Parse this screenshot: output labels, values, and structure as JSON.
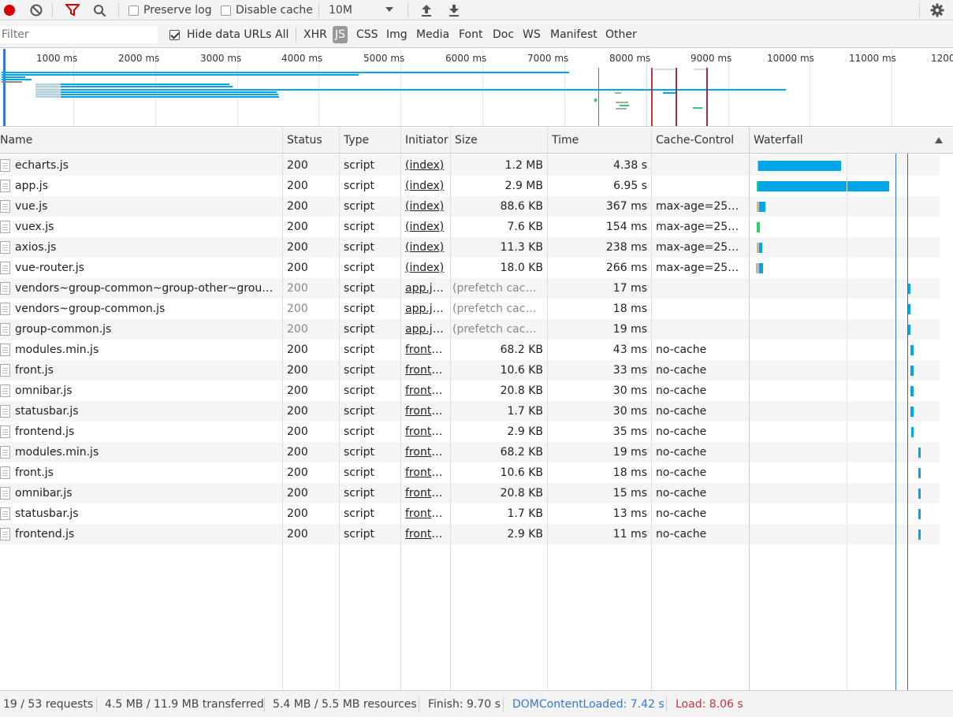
{
  "toolbar": {
    "preserve_log": "Preserve log",
    "disable_cache": "Disable cache",
    "throttle_value": "10M"
  },
  "filterbar": {
    "placeholder": "Filter",
    "hide_data_urls": "Hide data URLs",
    "types": [
      "All",
      "XHR",
      "JS",
      "CSS",
      "Img",
      "Media",
      "Font",
      "Doc",
      "WS",
      "Manifest",
      "Other"
    ],
    "active_type": "JS"
  },
  "overview": {
    "ticks": [
      "1000 ms",
      "2000 ms",
      "3000 ms",
      "4000 ms",
      "5000 ms",
      "6000 ms",
      "7000 ms",
      "8000 ms",
      "9000 ms",
      "10000 ms",
      "11000 ms",
      "1200"
    ]
  },
  "columns": {
    "name": "Name",
    "status": "Status",
    "type": "Type",
    "initiator": "Initiator",
    "size": "Size",
    "time": "Time",
    "cache_control": "Cache-Control",
    "waterfall": "Waterfall"
  },
  "rows": [
    {
      "name": "echarts.js",
      "status": "200",
      "type": "script",
      "initiator": "(index)",
      "size": "1.2 MB",
      "time": "4.38 s",
      "cache": ""
    },
    {
      "name": "app.js",
      "status": "200",
      "type": "script",
      "initiator": "(index)",
      "size": "2.9 MB",
      "time": "6.95 s",
      "cache": ""
    },
    {
      "name": "vue.js",
      "status": "200",
      "type": "script",
      "initiator": "(index)",
      "size": "88.6 KB",
      "time": "367 ms",
      "cache": "max-age=2592..."
    },
    {
      "name": "vuex.js",
      "status": "200",
      "type": "script",
      "initiator": "(index)",
      "size": "7.6 KB",
      "time": "154 ms",
      "cache": "max-age=2592..."
    },
    {
      "name": "axios.js",
      "status": "200",
      "type": "script",
      "initiator": "(index)",
      "size": "11.3 KB",
      "time": "238 ms",
      "cache": "max-age=2592..."
    },
    {
      "name": "vue-router.js",
      "status": "200",
      "type": "script",
      "initiator": "(index)",
      "size": "18.0 KB",
      "time": "266 ms",
      "cache": "max-age=2592..."
    },
    {
      "name": "vendors~group-common~group-other~group-...",
      "status": "200",
      "type": "script",
      "initiator": "app.js...",
      "size": "(prefetch cache)",
      "time": "17 ms",
      "cache": ""
    },
    {
      "name": "vendors~group-common.js",
      "status": "200",
      "type": "script",
      "initiator": "app.js...",
      "size": "(prefetch cache)",
      "time": "18 ms",
      "cache": ""
    },
    {
      "name": "group-common.js",
      "status": "200",
      "type": "script",
      "initiator": "app.js...",
      "size": "(prefetch cache)",
      "time": "19 ms",
      "cache": ""
    },
    {
      "name": "modules.min.js",
      "status": "200",
      "type": "script",
      "initiator": "fronte...",
      "size": "68.2 KB",
      "time": "43 ms",
      "cache": "no-cache"
    },
    {
      "name": "front.js",
      "status": "200",
      "type": "script",
      "initiator": "fronte...",
      "size": "10.6 KB",
      "time": "33 ms",
      "cache": "no-cache"
    },
    {
      "name": "omnibar.js",
      "status": "200",
      "type": "script",
      "initiator": "fronte...",
      "size": "20.8 KB",
      "time": "30 ms",
      "cache": "no-cache"
    },
    {
      "name": "statusbar.js",
      "status": "200",
      "type": "script",
      "initiator": "fronte...",
      "size": "1.7 KB",
      "time": "30 ms",
      "cache": "no-cache"
    },
    {
      "name": "frontend.js",
      "status": "200",
      "type": "script",
      "initiator": "fronte...",
      "size": "2.9 KB",
      "time": "35 ms",
      "cache": "no-cache"
    },
    {
      "name": "modules.min.js",
      "status": "200",
      "type": "script",
      "initiator": "fronte...",
      "size": "68.2 KB",
      "time": "19 ms",
      "cache": "no-cache"
    },
    {
      "name": "front.js",
      "status": "200",
      "type": "script",
      "initiator": "fronte...",
      "size": "10.6 KB",
      "time": "18 ms",
      "cache": "no-cache"
    },
    {
      "name": "omnibar.js",
      "status": "200",
      "type": "script",
      "initiator": "fronte...",
      "size": "20.8 KB",
      "time": "15 ms",
      "cache": "no-cache"
    },
    {
      "name": "statusbar.js",
      "status": "200",
      "type": "script",
      "initiator": "fronte...",
      "size": "1.7 KB",
      "time": "13 ms",
      "cache": "no-cache"
    },
    {
      "name": "frontend.js",
      "status": "200",
      "type": "script",
      "initiator": "fronte...",
      "size": "2.9 KB",
      "time": "11 ms",
      "cache": "no-cache"
    }
  ],
  "status": {
    "requests": "19 / 53 requests",
    "transferred": "4.5 MB / 11.9 MB transferred",
    "resources": "5.4 MB / 5.5 MB resources",
    "finish": "Finish: 9.70 s",
    "dcl": "DOMContentLoaded: 7.42 s",
    "load": "Load: 8.06 s"
  },
  "colors": {
    "bar": "#00a6e8",
    "dcl": "#3577d4",
    "load": "#c8343f",
    "record": "#d80000"
  }
}
